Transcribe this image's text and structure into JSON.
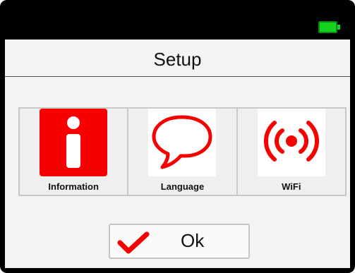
{
  "status": {
    "battery_icon": "battery-full-icon",
    "battery_color": "#15d21f"
  },
  "header": {
    "title": "Setup"
  },
  "menu": {
    "items": [
      {
        "label": "Information",
        "icon": "information-icon",
        "selected": true
      },
      {
        "label": "Language",
        "icon": "speech-bubble-icon",
        "selected": false
      },
      {
        "label": "WiFi",
        "icon": "wifi-signal-icon",
        "selected": false
      }
    ]
  },
  "actions": {
    "ok_label": "Ok",
    "ok_icon": "checkmark-icon"
  },
  "colors": {
    "accent": "#f60000",
    "background": "#000000",
    "screen": "#f3f3f3"
  }
}
